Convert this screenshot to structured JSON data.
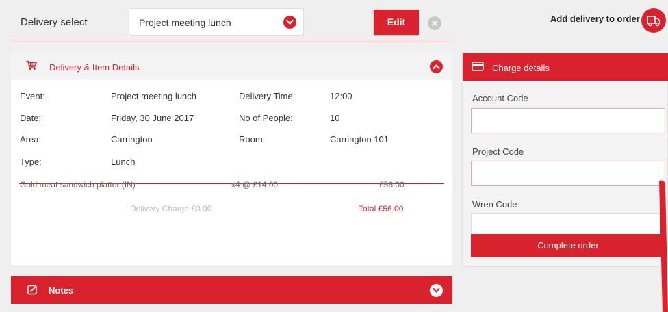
{
  "topbar": {
    "delivery_select_label": "Delivery select",
    "selected_delivery": "Project meeting lunch",
    "edit_label": "Edit",
    "add_delivery_label": "Add delivery to order"
  },
  "delivery_panel": {
    "title": "Delivery & Item Details",
    "details": [
      {
        "label": "Event:",
        "value": "Project meeting lunch"
      },
      {
        "label": "Delivery Time:",
        "value": "12:00"
      },
      {
        "label": "Date:",
        "value": "Friday, 30 June 2017"
      },
      {
        "label": "No of People:",
        "value": "10"
      },
      {
        "label": "Area:",
        "value": "Carrington"
      },
      {
        "label": "Room:",
        "value": "Carrington 101"
      },
      {
        "label": "Type:",
        "value": "Lunch"
      }
    ],
    "items": [
      {
        "name": "Gold meat sandwich platter (IN)",
        "qty": "x4 @ £14.00",
        "price": "£56.00"
      }
    ],
    "delivery_charge": "Delivery Charge £0.00",
    "total": "Total £56.00"
  },
  "notes": {
    "label": "Notes"
  },
  "charge_panel": {
    "title": "Charge details",
    "account_code_label": "Account Code",
    "account_code_value": "",
    "project_code_label": "Project Code",
    "project_code_value": "",
    "wren_code_label": "Wren Code",
    "wren_code_value": "",
    "complete_label": "Complete order"
  },
  "colors": {
    "accent": "#d8232f",
    "background": "#efefef",
    "panel": "#ffffff"
  },
  "icons": {
    "select_chevron": "chevron-down-icon",
    "clear": "close-icon",
    "truck": "truck-icon",
    "cart": "cart-icon",
    "collapse": "chevron-up-icon",
    "notes": "pencil-icon",
    "expand": "chevron-down-icon",
    "card": "credit-card-icon"
  }
}
